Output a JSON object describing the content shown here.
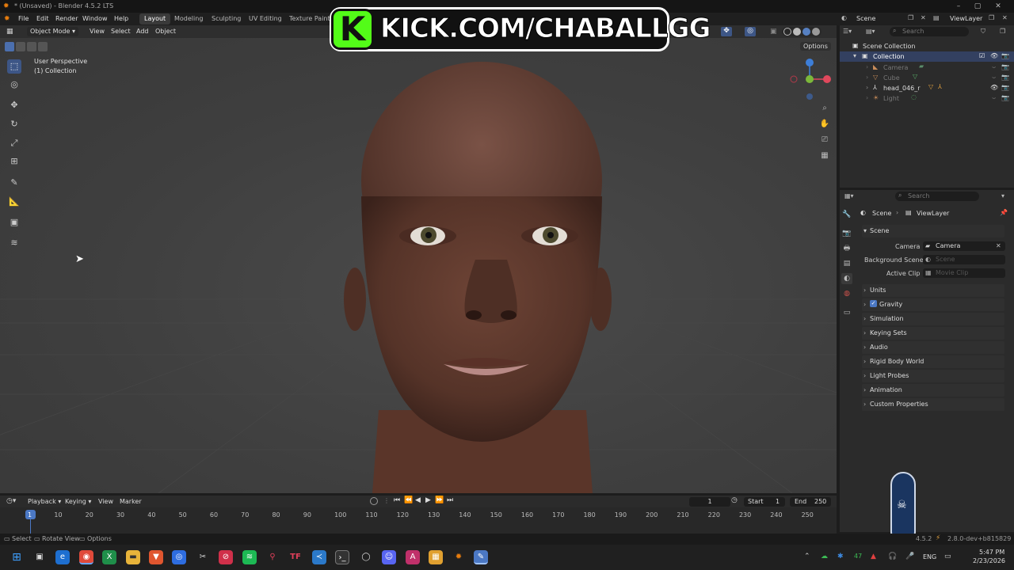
{
  "window": {
    "title": "* (Unsaved) - Blender 4.5.2 LTS"
  },
  "menu": [
    "File",
    "Edit",
    "Render",
    "Window",
    "Help"
  ],
  "workspaces": [
    "Layout",
    "Modeling",
    "Sculpting",
    "UV Editing",
    "Texture Paint"
  ],
  "active_workspace": "Layout",
  "overlay_banner": {
    "text": "KICK.COM/CHABALLGG",
    "logo_letter": "K",
    "accent": "#53fc18"
  },
  "scene_selector": {
    "scene": "Scene",
    "view_layer": "ViewLayer"
  },
  "viewport": {
    "mode": "Object Mode",
    "menus": [
      "View",
      "Select",
      "Add",
      "Object"
    ],
    "info_line1": "User Perspective",
    "info_line2": "(1) Collection",
    "options_label": "Options"
  },
  "outliner": {
    "search_placeholder": "Search",
    "root": "Scene Collection",
    "collection": "Collection",
    "items": [
      "Camera",
      "Cube",
      "head_046_r",
      "Light"
    ]
  },
  "properties": {
    "search_placeholder": "Search",
    "breadcrumb_scene": "Scene",
    "breadcrumb_layer": "ViewLayer",
    "section": "Scene",
    "fields": [
      {
        "label": "Camera",
        "value": "Camera"
      },
      {
        "label": "Background Scene",
        "value": "Scene"
      },
      {
        "label": "Active Clip",
        "value": "Movie Clip"
      }
    ],
    "panels": [
      "Units",
      "Gravity",
      "Simulation",
      "Keying Sets",
      "Audio",
      "Rigid Body World",
      "Light Probes",
      "Animation",
      "Custom Properties"
    ]
  },
  "timeline": {
    "menus": [
      "Playback",
      "Keying",
      "View",
      "Marker"
    ],
    "current_frame": "1",
    "start_label": "Start",
    "start": "1",
    "end_label": "End",
    "end": "250",
    "ticks": [
      "1",
      "10",
      "20",
      "30",
      "40",
      "50",
      "60",
      "70",
      "80",
      "90",
      "100",
      "110",
      "120",
      "130",
      "140",
      "150",
      "160",
      "170",
      "180",
      "190",
      "200",
      "210",
      "220",
      "230",
      "240",
      "250"
    ]
  },
  "statusbar": {
    "select": "Select",
    "rotate": "Rotate View",
    "options": "Options",
    "version": "4.5.2",
    "addon_version": "2.8.0-dev+b815829"
  },
  "taskbar": {
    "lang": "ENG",
    "time": "5:47 PM",
    "date": "2/23/2026",
    "temp": "47"
  }
}
